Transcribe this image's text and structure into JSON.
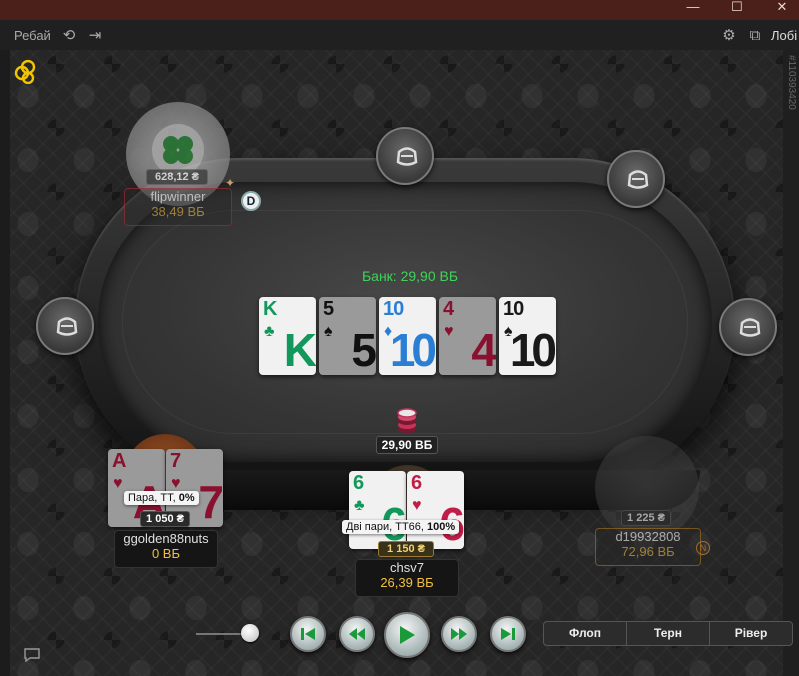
{
  "window": {
    "minimize": "—",
    "maximize": "☐",
    "close": "✕"
  },
  "toolbar": {
    "rebuy_label": "Ребай",
    "lobby_label": "Лобі"
  },
  "hand_id": "#110393420",
  "pot": {
    "label": "Банк: 29,90 ВБ"
  },
  "board": [
    {
      "rank": "K",
      "suit": "♣",
      "color": "club",
      "dim": false
    },
    {
      "rank": "5",
      "suit": "♠",
      "color": "spade",
      "dim": true
    },
    {
      "rank": "10",
      "suit": "♦",
      "color": "diam",
      "dim": false
    },
    {
      "rank": "4",
      "suit": "♥",
      "color": "heart",
      "dim": true
    },
    {
      "rank": "10",
      "suit": "♠",
      "color": "spade",
      "dim": false
    }
  ],
  "center_bet": "29,90 ВБ",
  "players": {
    "flipwinner": {
      "name": "flipwinner",
      "stack": "38,49 ВБ",
      "bet": "628,12 ₴"
    },
    "ggolden": {
      "name": "ggolden88nuts",
      "stack": "0 ВБ",
      "hand": "Пара, ТТ, ",
      "hand_pct": "0%",
      "bet": "1 050 ₴",
      "cards": [
        {
          "rank": "A",
          "suit": "♥"
        },
        {
          "rank": "7",
          "suit": "♥"
        }
      ]
    },
    "hero": {
      "name": "chsv7",
      "stack": "26,39 ВБ",
      "hand": "Дві пари, TT66, ",
      "hand_pct": "100%",
      "bet": "1 150 ₴",
      "cards": [
        {
          "rank": "6",
          "suit": "♣"
        },
        {
          "rank": "6",
          "suit": "♥"
        }
      ]
    },
    "d199": {
      "name": "d19932808",
      "stack": "72,96 ВБ",
      "bet": "1 225 ₴"
    }
  },
  "dealer": "D",
  "streets": [
    "Флоп",
    "Терн",
    "Рівер"
  ]
}
